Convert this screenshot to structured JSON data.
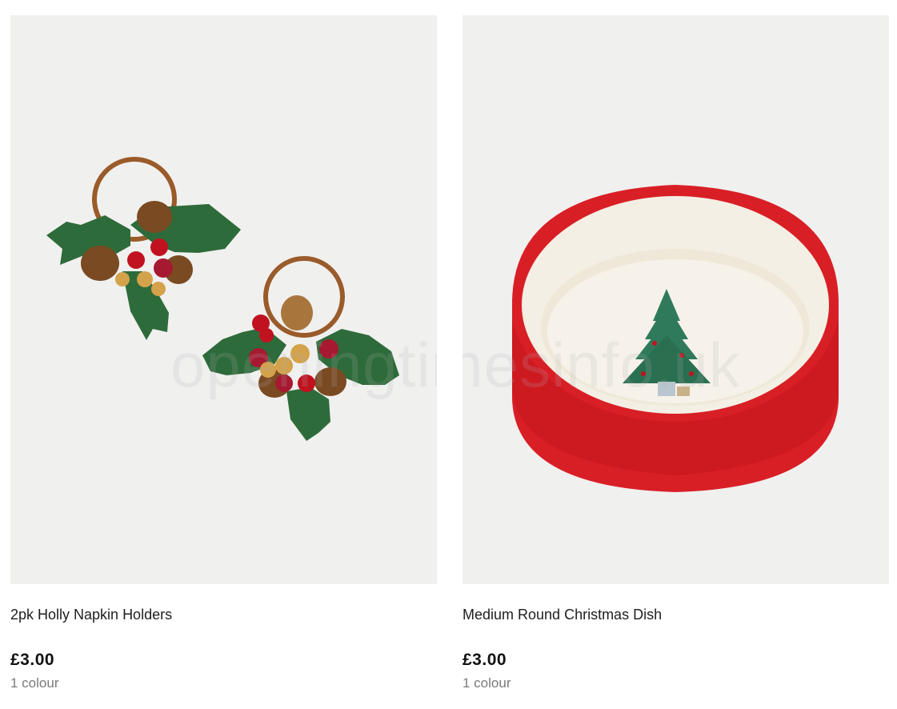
{
  "watermark": "openingtimesinfo.uk",
  "products": [
    {
      "image_alt": "2pk Holly Napkin Holders",
      "title": "2pk Holly Napkin Holders",
      "price": "£3.00",
      "colours": "1 colour"
    },
    {
      "image_alt": "Medium Round Christmas Dish",
      "title": "Medium Round Christmas Dish",
      "price": "£3.00",
      "colours": "1 colour"
    }
  ],
  "colors": {
    "image_bg": "#f0f0ef",
    "holly_green": "#2e6b3a",
    "berry_red": "#c1121f",
    "dish_red": "#d91f26",
    "dish_inner": "#f4efe4",
    "muted_text": "#7a7a7a"
  }
}
